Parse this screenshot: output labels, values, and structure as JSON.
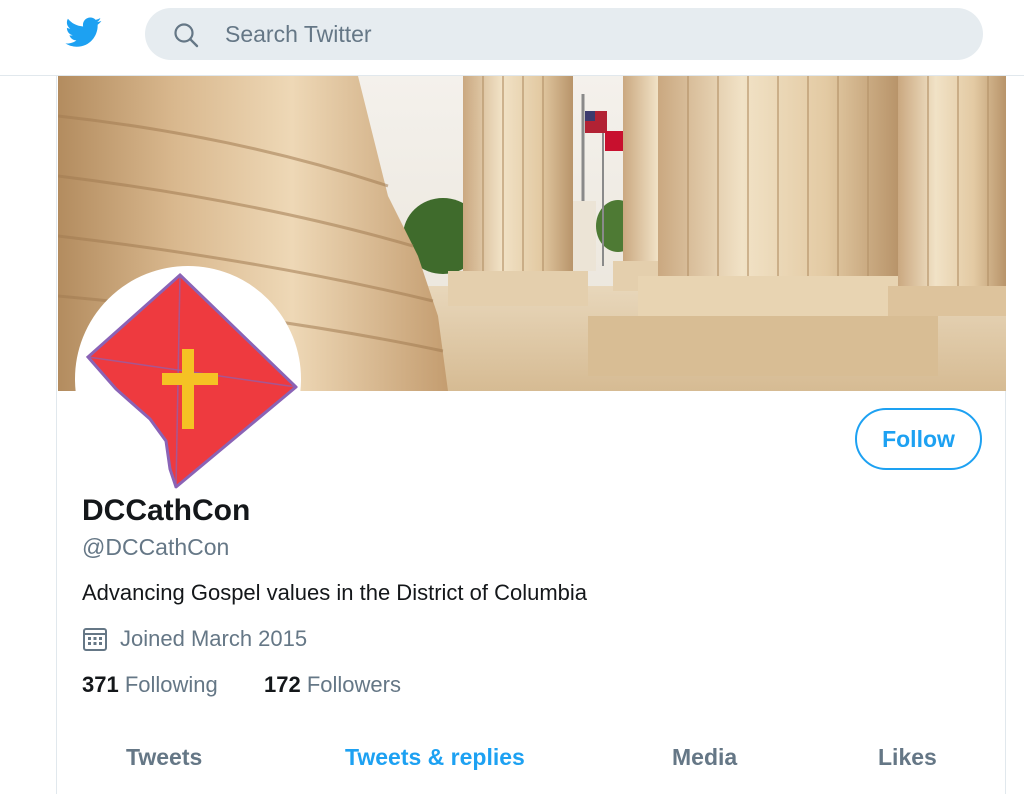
{
  "header": {
    "logo": "twitter-bird-icon",
    "search": {
      "placeholder": "Search Twitter",
      "value": "",
      "icon": "search-icon"
    }
  },
  "profile": {
    "banner": "supreme-court-columns-photo",
    "avatar": "dc-map-with-cross-logo",
    "display_name": "DCCathCon",
    "handle": "@DCCathCon",
    "bio": "Advancing Gospel values in the District of Columbia",
    "joined": "Joined March 2015",
    "joined_icon": "calendar-icon",
    "follow_label": "Follow",
    "stats": {
      "following_count": "371",
      "following_label": "Following",
      "followers_count": "172",
      "followers_label": "Followers"
    }
  },
  "tabs": [
    {
      "label": "Tweets",
      "active": false
    },
    {
      "label": "Tweets & replies",
      "active": true
    },
    {
      "label": "Media",
      "active": false
    },
    {
      "label": "Likes",
      "active": false
    }
  ],
  "colors": {
    "accent": "#1da1f2",
    "text": "#14171a",
    "secondary": "#657786",
    "search_bg": "#e6ecf0",
    "avatar_red": "#ee3a3f",
    "avatar_cross": "#f5c224"
  }
}
